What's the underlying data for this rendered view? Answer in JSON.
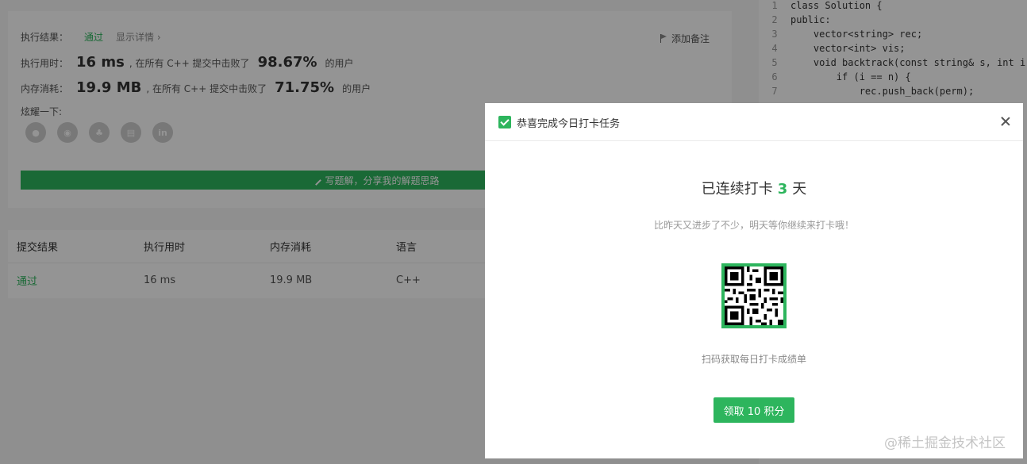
{
  "result": {
    "exec_result_label": "执行结果：",
    "status": "通过",
    "show_detail": "显示详情 ›",
    "add_note": "添加备注",
    "runtime_label": "执行用时：",
    "runtime_value": "16 ms",
    "runtime_mid": ", 在所有 C++ 提交中击败了",
    "runtime_pct": "98.67%",
    "runtime_tail": "的用户",
    "memory_label": "内存消耗：",
    "memory_value": "19.9 MB",
    "memory_mid": ", 在所有 C++ 提交中击败了",
    "memory_pct": "71.75%",
    "memory_tail": "的用户",
    "share_label": "炫耀一下:",
    "share_icons": [
      "wechat-icon",
      "weibo-icon",
      "qq-icon",
      "douban-icon",
      "linkedin-icon"
    ],
    "write_solution": "写题解，分享我的解题思路"
  },
  "submissions": {
    "headers": [
      "提交结果",
      "执行用时",
      "内存消耗",
      "语言"
    ],
    "row": [
      "通过",
      "16 ms",
      "19.9 MB",
      "C++"
    ]
  },
  "editor": {
    "lines": [
      {
        "n": "1",
        "text": "class Solution {"
      },
      {
        "n": "2",
        "text": "public:"
      },
      {
        "n": "3",
        "text": "    vector<string> rec;"
      },
      {
        "n": "4",
        "text": "    vector<int> vis;"
      },
      {
        "n": "5",
        "text": "    void backtrack(const string& s, int i"
      },
      {
        "n": "6",
        "text": "        if (i == n) {"
      },
      {
        "n": "7",
        "text": "            rec.push_back(perm);"
      }
    ]
  },
  "modal": {
    "title": "恭喜完成今日打卡任务",
    "streak_prefix": "已连续打卡",
    "streak_days": "3",
    "streak_suffix": "天",
    "encourage": "比昨天又进步了不少，明天等你继续来打卡哦！",
    "scan_text": "扫码获取每日打卡成绩单",
    "claim_button": "领取 10 积分"
  },
  "watermark": "@稀土掘金技术社区",
  "colors": {
    "accent": "#2db55d"
  }
}
